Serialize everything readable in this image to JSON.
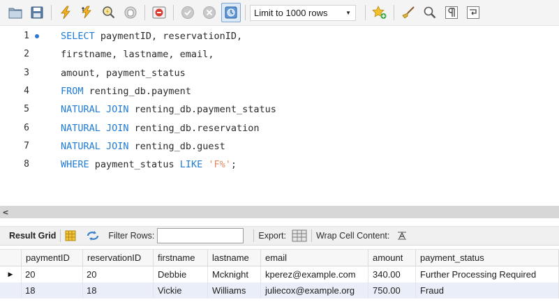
{
  "toolbar": {
    "limit_label": "Limit to 1000 rows"
  },
  "editor": {
    "lines": [
      {
        "n": "1",
        "segments": [
          {
            "t": "SELECT ",
            "c": "kw"
          },
          {
            "t": "paymentID, reservationID,",
            "c": ""
          }
        ]
      },
      {
        "n": "2",
        "segments": [
          {
            "t": "firstname, lastname, email,",
            "c": ""
          }
        ]
      },
      {
        "n": "3",
        "segments": [
          {
            "t": "amount, payment_status",
            "c": ""
          }
        ]
      },
      {
        "n": "4",
        "segments": [
          {
            "t": "FROM ",
            "c": "kw"
          },
          {
            "t": "renting_db.payment",
            "c": ""
          }
        ]
      },
      {
        "n": "5",
        "segments": [
          {
            "t": "NATURAL JOIN ",
            "c": "kw"
          },
          {
            "t": "renting_db.payment_status",
            "c": ""
          }
        ]
      },
      {
        "n": "6",
        "segments": [
          {
            "t": "NATURAL JOIN ",
            "c": "kw"
          },
          {
            "t": "renting_db.reservation",
            "c": ""
          }
        ]
      },
      {
        "n": "7",
        "segments": [
          {
            "t": "NATURAL JOIN ",
            "c": "kw"
          },
          {
            "t": "renting_db.guest",
            "c": ""
          }
        ]
      },
      {
        "n": "8",
        "segments": [
          {
            "t": "WHERE ",
            "c": "kw"
          },
          {
            "t": "payment_status ",
            "c": ""
          },
          {
            "t": "LIKE ",
            "c": "kw"
          },
          {
            "t": "'F%'",
            "c": "str"
          },
          {
            "t": ";",
            "c": ""
          }
        ]
      }
    ]
  },
  "result_toolbar": {
    "result_grid": "Result Grid",
    "filter_rows": "Filter Rows:",
    "export": "Export:",
    "wrap_cell": "Wrap Cell Content:"
  },
  "grid": {
    "columns": [
      "paymentID",
      "reservationID",
      "firstname",
      "lastname",
      "email",
      "amount",
      "payment_status"
    ],
    "rows": [
      [
        "20",
        "20",
        "Debbie",
        "Mcknight",
        "kperez@example.com",
        "340.00",
        "Further Processing Required"
      ],
      [
        "18",
        "18",
        "Vickie",
        "Williams",
        "juliecox@example.org",
        "750.00",
        "Fraud"
      ]
    ]
  },
  "colors": {
    "keyword": "#1f7bd6",
    "string": "#e3885f",
    "breakpoint": "#2e78d4",
    "selected_row": "#e9eef8"
  }
}
